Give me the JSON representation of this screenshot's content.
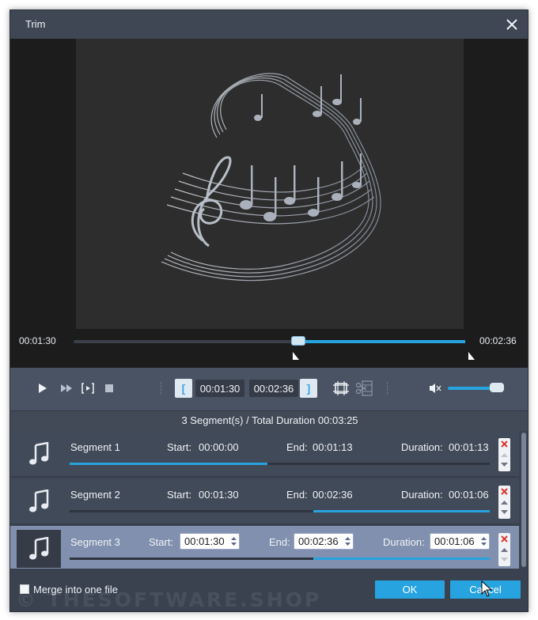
{
  "window": {
    "title": "Trim",
    "close_icon": "close-icon"
  },
  "preview": {
    "artwork": "music-notes-artwork",
    "current_time": "00:01:30",
    "end_time": "00:02:36",
    "playhead_fraction": 0.582,
    "selection_start_fraction": 0.578,
    "selection_end_fraction": 1.0
  },
  "controls": {
    "play_icon": "play-icon",
    "fast_forward_icon": "fast-forward-icon",
    "play_segment_icon": "play-segment-icon",
    "stop_icon": "stop-icon",
    "set_start_icon": "set-start-bracket-icon",
    "start_time": "00:01:30",
    "end_time": "00:02:36",
    "set_end_icon": "set-end-bracket-icon",
    "add_segment_icon": "add-segment-icon",
    "split_icon": "scissors-icon",
    "volume_icon": "volume-icon",
    "volume_level": 0.88
  },
  "summary": "3 Segment(s) / Total Duration 00:03:25",
  "labels": {
    "start": "Start:",
    "end": "End:",
    "duration": "Duration:"
  },
  "segments": [
    {
      "name": "Segment 1",
      "start": "00:00:00",
      "end": "00:01:13",
      "duration": "00:01:13",
      "range": [
        0.0,
        0.47
      ],
      "selected": false
    },
    {
      "name": "Segment 2",
      "start": "00:01:30",
      "end": "00:02:36",
      "duration": "00:01:06",
      "range": [
        0.58,
        1.0
      ],
      "selected": false
    },
    {
      "name": "Segment 3",
      "start": "00:01:30",
      "end": "00:02:36",
      "duration": "00:01:06",
      "range": [
        0.58,
        1.0
      ],
      "selected": true
    }
  ],
  "footer": {
    "merge_label": "Merge into one file",
    "merge_checked": false,
    "ok_label": "OK",
    "cancel_label": "Cancel"
  },
  "watermark": "© THESOFTWARE.SHOP",
  "colors": {
    "accent": "#27a3e0",
    "dialog_bg": "#3a4250",
    "selected_row": "#8190ae",
    "delete_red": "#d9342b"
  }
}
